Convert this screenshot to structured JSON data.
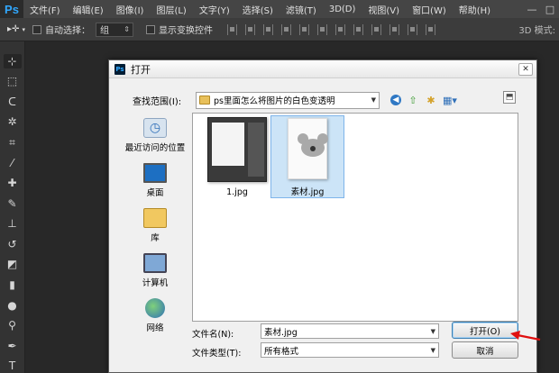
{
  "app": {
    "logo": "Ps"
  },
  "menubar": {
    "items": [
      "文件(F)",
      "编辑(E)",
      "图像(I)",
      "图层(L)",
      "文字(Y)",
      "选择(S)",
      "滤镜(T)",
      "3D(D)",
      "视图(V)",
      "窗口(W)",
      "帮助(H)"
    ],
    "win_min": "—",
    "win_max": "□"
  },
  "options": {
    "auto_select_label": "自动选择：",
    "auto_select_value": "组",
    "show_transform_label": "显示变换控件",
    "mode3d_label": "3D 模式:"
  },
  "tools": [
    "move-tool",
    "marquee-tool",
    "lasso-tool",
    "magic-wand-tool",
    "crop-tool",
    "eyedropper-tool",
    "healing-tool",
    "brush-tool",
    "stamp-tool",
    "history-brush-tool",
    "eraser-tool",
    "gradient-tool",
    "blur-tool",
    "dodge-tool",
    "pen-tool",
    "type-tool"
  ],
  "dialog": {
    "title_icon": "Ps",
    "title": "打开",
    "close_label": "✕",
    "look_in_label": "查找范围(I):",
    "look_in_value": "ps里面怎么将图片的白色变透明",
    "places": [
      {
        "label": "最近访问的位置",
        "icon": "recent-places-icon"
      },
      {
        "label": "桌面",
        "icon": "desktop-icon"
      },
      {
        "label": "库",
        "icon": "libraries-icon"
      },
      {
        "label": "计算机",
        "icon": "computer-icon"
      },
      {
        "label": "网络",
        "icon": "network-icon"
      }
    ],
    "files": [
      {
        "name": "1.jpg",
        "selected": false
      },
      {
        "name": "素材.jpg",
        "selected": true
      }
    ],
    "filename_label": "文件名(N):",
    "filename_value": "素材.jpg",
    "filetype_label": "文件类型(T):",
    "filetype_value": "所有格式",
    "open_button": "打开(O)",
    "cancel_button": "取消"
  },
  "colors": {
    "accent": "#31a8ff",
    "arrow": "#e01010",
    "selection": "#cce4f7"
  }
}
